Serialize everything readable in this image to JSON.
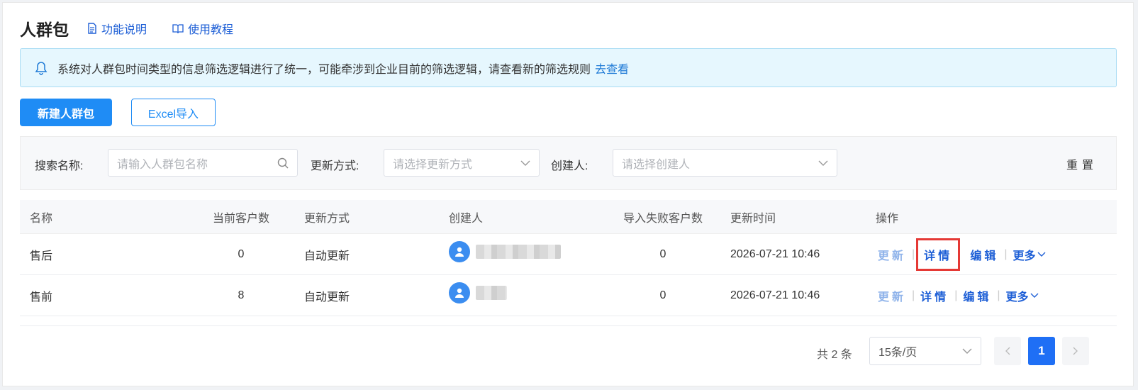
{
  "header": {
    "title": "人群包",
    "link_features": "功能说明",
    "link_tutorial": "使用教程"
  },
  "notice": {
    "text": "系统对人群包时间类型的信息筛选逻辑进行了统一，可能牵涉到企业目前的筛选逻辑，请查看新的筛选规则",
    "link": "去查看"
  },
  "toolbar": {
    "new_label": "新建人群包",
    "import_label": "Excel导入"
  },
  "filters": {
    "search_label": "搜索名称:",
    "search_placeholder": "请输入人群包名称",
    "update_label": "更新方式:",
    "update_placeholder": "请选择更新方式",
    "creator_label": "创建人:",
    "creator_placeholder": "请选择创建人",
    "reset_label": "重置"
  },
  "table": {
    "headers": [
      "名称",
      "当前客户数",
      "更新方式",
      "创建人",
      "导入失败客户数",
      "更新时间",
      "操作"
    ],
    "rows": [
      {
        "name": "售后",
        "count": "0",
        "mode": "自动更新",
        "failed": "0",
        "time": "2026-07-21 10:46"
      },
      {
        "name": "售前",
        "count": "8",
        "mode": "自动更新",
        "failed": "0",
        "time": "2026-07-21 10:46"
      }
    ],
    "ops": {
      "update": "更新",
      "detail": "详情",
      "edit": "编辑",
      "more": "更多"
    }
  },
  "pagination": {
    "total": "共 2 条",
    "page_size": "15条/页",
    "current": "1"
  },
  "colors": {
    "primary": "#1f8cf5",
    "link": "#1e5fd6",
    "highlight": "#e53935"
  }
}
